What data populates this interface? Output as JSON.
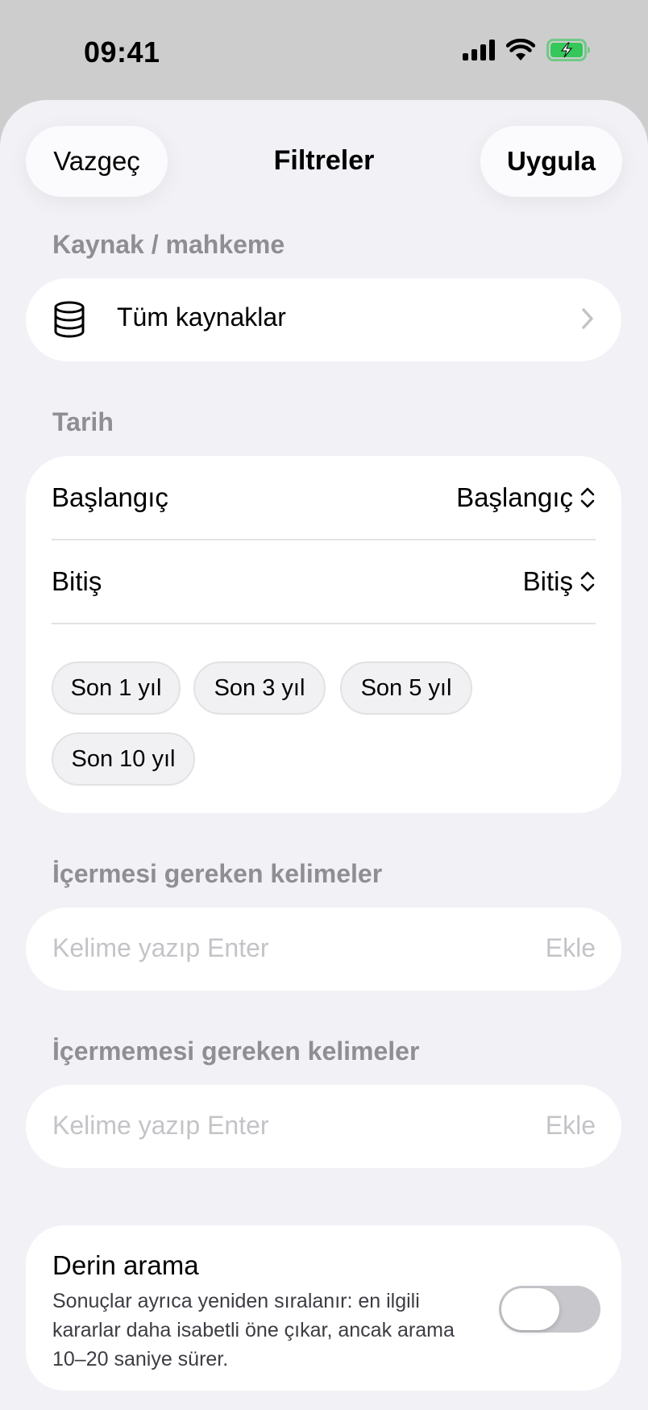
{
  "status_bar": {
    "time": "09:41"
  },
  "header": {
    "cancel_label": "Vazgeç",
    "title": "Filtreler",
    "apply_label": "Uygula"
  },
  "source": {
    "section_label": "Kaynak / mahkeme",
    "value": "Tüm kaynaklar",
    "icon": "database-icon"
  },
  "date": {
    "section_label": "Tarih",
    "start": {
      "label": "Başlangıç",
      "value": "Başlangıç"
    },
    "end": {
      "label": "Bitiş",
      "value": "Bitiş"
    },
    "chips": [
      "Son 1 yıl",
      "Son 3 yıl",
      "Son 5 yıl",
      "Son 10 yıl"
    ]
  },
  "include_words": {
    "section_label": "İçermesi gereken kelimeler",
    "placeholder": "Kelime yazıp Enter",
    "add_label": "Ekle"
  },
  "exclude_words": {
    "section_label": "İçermemesi gereken kelimeler",
    "placeholder": "Kelime yazıp Enter",
    "add_label": "Ekle"
  },
  "deep_search": {
    "title": "Derin arama",
    "description": "Sonuçlar ayrıca yeniden sıralanır: en ilgili kararlar daha isabetli öne çıkar, ancak arama 10–20 saniye sürer.",
    "enabled": false
  },
  "colors": {
    "accent_battery": "#34c759",
    "sheet_bg": "#f1f1f6",
    "secondary_label": "#8e8e93"
  }
}
